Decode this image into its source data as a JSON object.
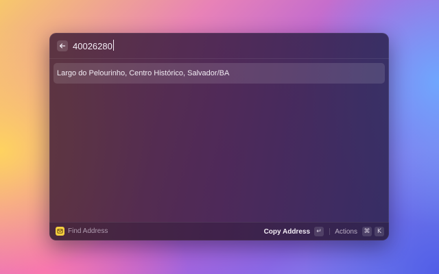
{
  "search": {
    "value": "40026280",
    "back_icon": "arrow-left-icon"
  },
  "results": [
    {
      "label": "Largo do Pelourinho, Centro Histórico, Salvador/BA",
      "selected": true
    }
  ],
  "footer": {
    "app_icon": "envelope-icon",
    "title": "Find Address",
    "primary_action": "Copy Address",
    "primary_shortcut": "↵",
    "actions_label": "Actions",
    "actions_shortcut": [
      "⌘",
      "K"
    ]
  },
  "colors": {
    "app_icon_bg": "#f5cf3f",
    "text": "#f4eef6"
  }
}
